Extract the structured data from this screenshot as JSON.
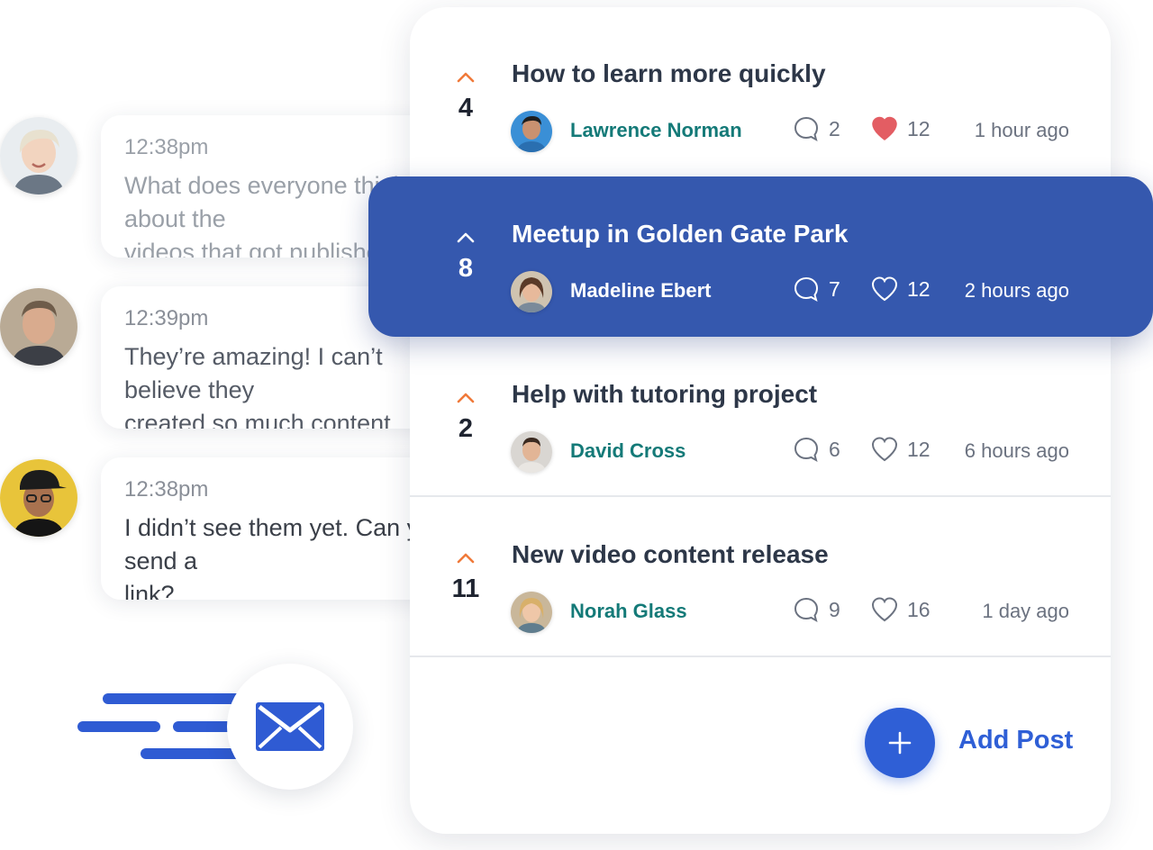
{
  "chat": {
    "messages": [
      {
        "time": "12:38pm",
        "text": "What does everyone think about the\nvideos that got published?"
      },
      {
        "time": "12:39pm",
        "text": "They’re amazing! I can’t believe they\ncreated so much content"
      },
      {
        "time": "12:38pm",
        "text": "I didn’t see them yet. Can you send a\nlink?"
      }
    ]
  },
  "feed": {
    "posts": [
      {
        "votes": "4",
        "title": "How to learn more quickly",
        "author": "Lawrence Norman",
        "comments": "2",
        "likes": "12",
        "liked": true,
        "time": "1 hour ago"
      },
      {
        "votes": "8",
        "title": "Meetup in Golden Gate Park",
        "author": "Madeline Ebert",
        "comments": "7",
        "likes": "12",
        "liked": false,
        "time": "2 hours ago"
      },
      {
        "votes": "2",
        "title": "Help with tutoring project",
        "author": "David Cross",
        "comments": "6",
        "likes": "12",
        "liked": false,
        "time": "6 hours ago"
      },
      {
        "votes": "11",
        "title": "New video content release",
        "author": "Norah Glass",
        "comments": "9",
        "likes": "16",
        "liked": false,
        "time": "1 day ago"
      }
    ],
    "add_post_label": "Add Post"
  },
  "colors": {
    "accent": "#2f5fd6",
    "active_row": "#3558ae",
    "author": "#147a78",
    "upvote": "#f07a3a",
    "heart": "#e35d63"
  },
  "icons": [
    "upvote-caret-icon",
    "comment-icon",
    "heart-icon",
    "plus-icon",
    "envelope-icon"
  ]
}
